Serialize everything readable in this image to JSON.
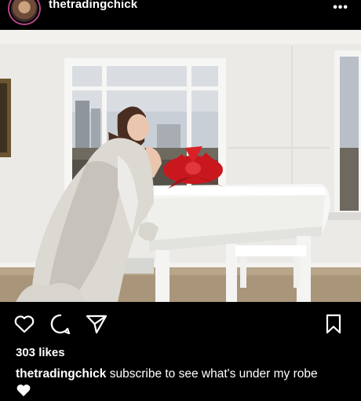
{
  "header": {
    "username": "thetradingchick",
    "more_icon": "more-horizontal-icon",
    "more_glyph": "•••"
  },
  "post": {
    "image_description": "",
    "likes": "303 likes",
    "caption_user": "thetradingchick",
    "caption_text": " subscribe to see what's under my robe"
  },
  "actions": {
    "like_icon": "heart-icon",
    "comment_icon": "comment-icon",
    "share_icon": "send-icon",
    "save_icon": "bookmark-icon"
  },
  "colors": {
    "background": "#000000",
    "text": "#ffffff",
    "avatar_ring": "#b7468c"
  }
}
